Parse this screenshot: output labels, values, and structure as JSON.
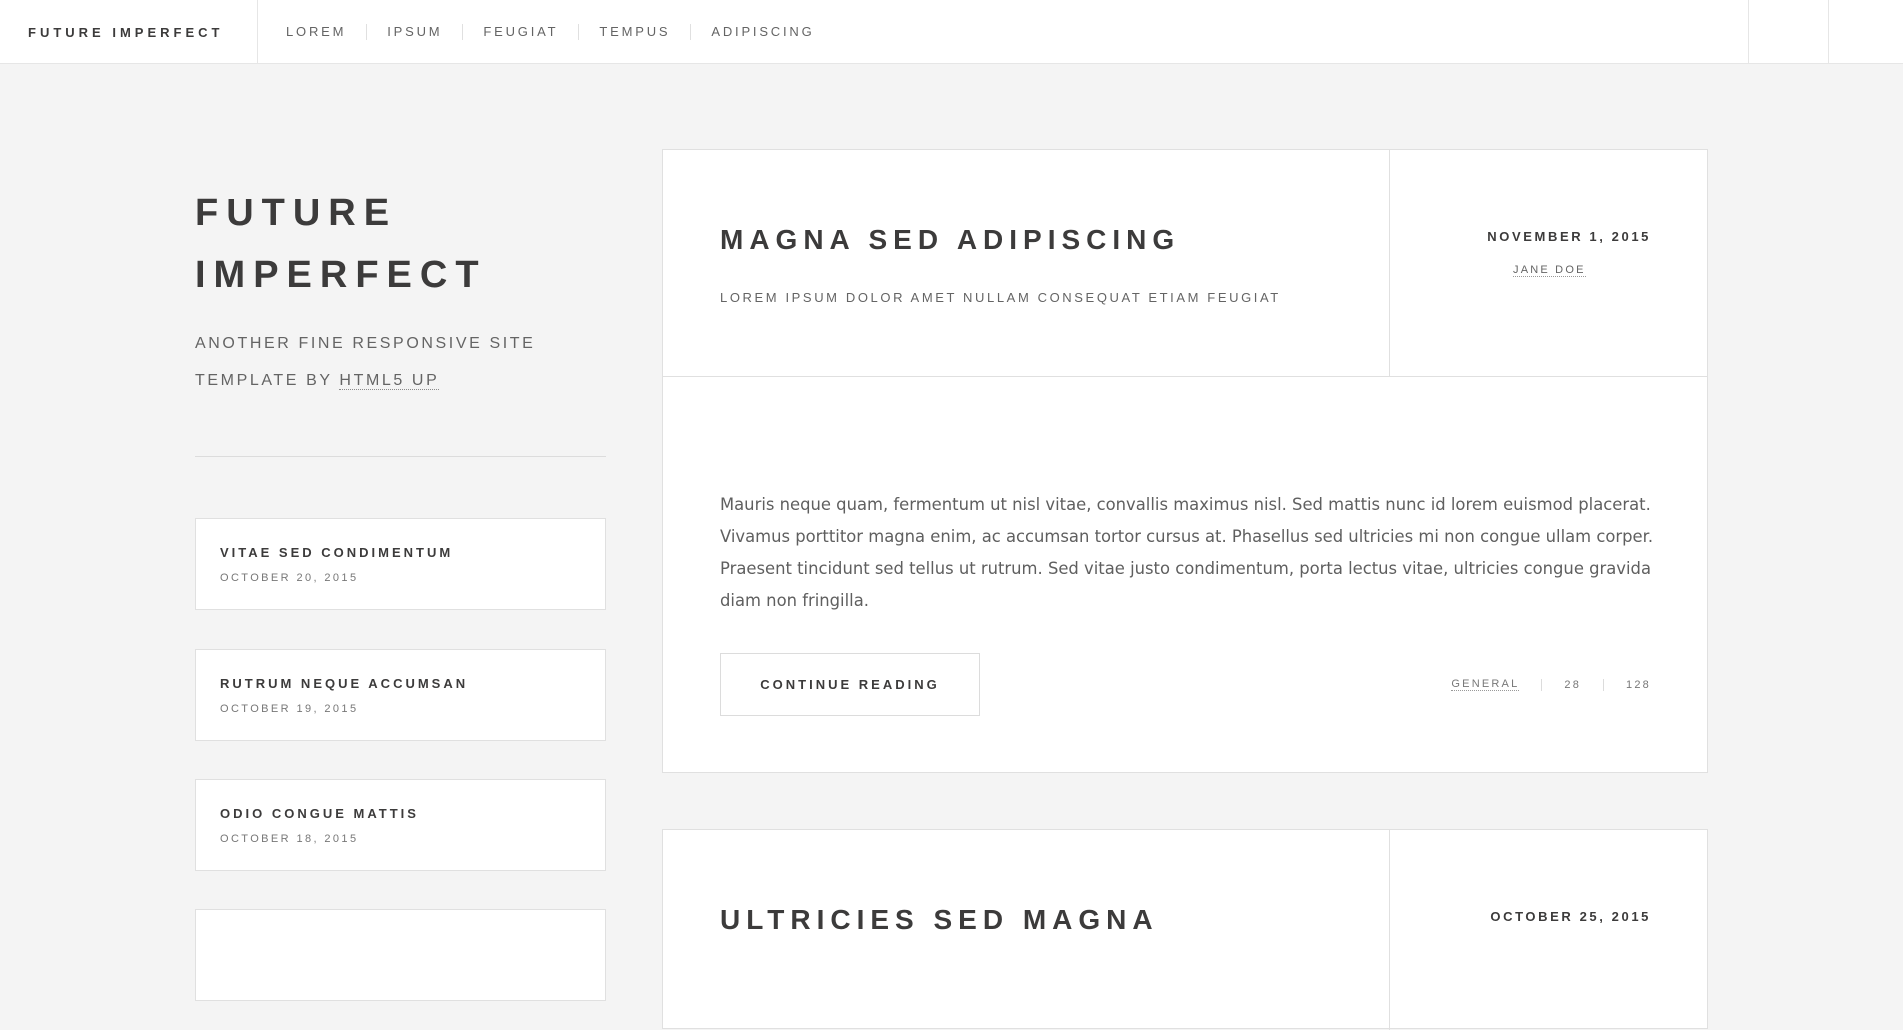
{
  "header": {
    "brand": "FUTURE IMPERFECT",
    "nav": [
      "LOREM",
      "IPSUM",
      "FEUGIAT",
      "TEMPUS",
      "ADIPISCING"
    ]
  },
  "intro": {
    "title_line1": "FUTURE",
    "title_line2": "IMPERFECT",
    "subtitle_line1": "ANOTHER FINE RESPONSIVE SITE",
    "subtitle_prefix": "TEMPLATE BY",
    "subtitle_link": "HTML5 UP"
  },
  "mini_posts": [
    {
      "title": "VITAE SED CONDIMENTUM",
      "date": "OCTOBER 20, 2015"
    },
    {
      "title": "RUTRUM NEQUE ACCUMSAN",
      "date": "OCTOBER 19, 2015"
    },
    {
      "title": "ODIO CONGUE MATTIS",
      "date": "OCTOBER 18, 2015"
    }
  ],
  "post": {
    "title": "MAGNA SED ADIPISCING",
    "subtitle": "LOREM IPSUM DOLOR AMET NULLAM CONSEQUAT ETIAM FEUGIAT",
    "date": "NOVEMBER 1, 2015",
    "author": "JANE DOE",
    "body": "Mauris neque quam, fermentum ut nisl vitae, convallis maximus nisl. Sed mattis nunc id lorem euismod placerat. Vivamus porttitor magna enim, ac accumsan tortor cursus at. Phasellus sed ultricies mi non congue ullam corper. Praesent tincidunt sed tellus ut rutrum. Sed vitae justo condimentum, porta lectus vitae, ultricies congue gravida diam non fringilla.",
    "continue_label": "CONTINUE READING",
    "category": "GENERAL",
    "likes": "28",
    "comments": "128"
  },
  "post2": {
    "title": "ULTRICIES SED MAGNA",
    "date": "OCTOBER 25, 2015"
  }
}
